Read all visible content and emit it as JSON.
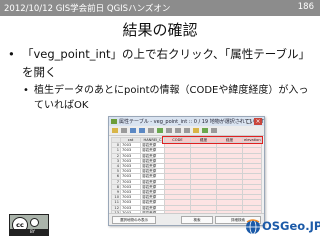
{
  "header": {
    "title": "2012/10/12 GIS学会前日 QGISハンズオン",
    "page_number": "186",
    "background": "#8c8c8c"
  },
  "slide": {
    "title": "結果の確認",
    "bullet1": "「veg_point_int」の上で右クリック、「属性テーブル」を開く",
    "bullet2": "植生データのあとにpointの情報（CODEや緯度経度）が入っていればOK"
  },
  "window": {
    "title": "属性テーブル - veg_point_int :: 0 / 19 地物が選択されています",
    "minimize": "–",
    "maximize": "□",
    "close": "×",
    "columns": [
      "",
      "cat",
      "HANREI_C",
      "CODE",
      "緯度",
      "経度",
      "elevation"
    ],
    "rows": [
      [
        "0",
        "7003",
        "溶岩荒原",
        "",
        "",
        "",
        ""
      ],
      [
        "1",
        "7003",
        "溶岩荒原",
        "",
        "",
        "",
        ""
      ],
      [
        "2",
        "7003",
        "溶岩荒原",
        "",
        "",
        "",
        ""
      ],
      [
        "3",
        "7003",
        "溶岩荒原",
        "",
        "",
        "",
        ""
      ],
      [
        "4",
        "7003",
        "溶岩荒原",
        "",
        "",
        "",
        ""
      ],
      [
        "5",
        "7003",
        "溶岩荒原",
        "",
        "",
        "",
        ""
      ],
      [
        "6",
        "7003",
        "溶岩荒原",
        "",
        "",
        "",
        ""
      ],
      [
        "7",
        "7003",
        "溶岩荒原",
        "",
        "",
        "",
        ""
      ],
      [
        "8",
        "7003",
        "溶岩荒原",
        "",
        "",
        "",
        ""
      ],
      [
        "9",
        "7003",
        "溶岩荒原",
        "",
        "",
        "",
        ""
      ],
      [
        "10",
        "7003",
        "溶岩荒原",
        "",
        "",
        "",
        ""
      ],
      [
        "11",
        "7003",
        "溶岩荒原",
        "",
        "",
        "",
        ""
      ],
      [
        "12",
        "7003",
        "溶岩荒原",
        "",
        "",
        "",
        ""
      ],
      [
        "13",
        "7003",
        "溶岩荒原",
        "",
        "",
        "",
        ""
      ],
      [
        "14",
        "7003",
        "溶岩荒原",
        "",
        "",
        "",
        ""
      ],
      [
        "15",
        "7003",
        "溶岩荒原",
        "",
        "",
        "",
        ""
      ],
      [
        "16",
        "7003",
        "溶岩荒原",
        "",
        "",
        "",
        ""
      ],
      [
        "17",
        "7003",
        "溶岩荒原",
        "",
        "",
        "",
        ""
      ],
      [
        "18",
        "7003",
        "溶岩荒原",
        "",
        "",
        "",
        ""
      ]
    ],
    "footer_buttons": [
      "選択地物のみ表示",
      "検索",
      "詳細検索"
    ],
    "highlight_color": "#e02020"
  },
  "license": {
    "cc": "cc",
    "label": "BY"
  },
  "logo": {
    "text": "OSGeo.JP",
    "color": "#1b5aa8"
  }
}
